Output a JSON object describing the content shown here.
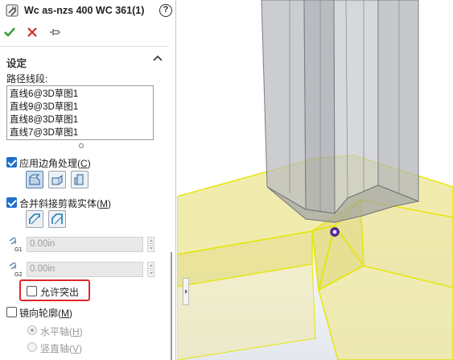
{
  "header": {
    "title": "Wc as-nzs 400 WC 361(1)",
    "help_glyph": "?"
  },
  "actions": {
    "ok_icon": "checkmark-icon",
    "cancel_icon": "close-icon",
    "pin_icon": "pushpin-icon",
    "ok_color": "#2a9a2a",
    "cancel_color": "#d22b2b"
  },
  "settings": {
    "title": "设定",
    "path_label": "路径线段:",
    "path_segments": [
      "直线6@3D草图1",
      "直线9@3D草图1",
      "直线8@3D草图1",
      "直线7@3D草图1"
    ],
    "corner_treatment": {
      "label": "应用边角处理",
      "hotkey": "C",
      "checked": true
    },
    "merge_miter": {
      "label": "合并斜接剪裁实体",
      "hotkey": "M",
      "checked": true
    },
    "gap1": {
      "value": "0.00in",
      "icon": "gap-g1-icon"
    },
    "gap2": {
      "value": "0.00in",
      "icon": "gap-g2-icon"
    },
    "allow_protrusion": {
      "label": "允许突出",
      "checked": false
    },
    "mirror_profile": {
      "label": "镜向轮廓",
      "hotkey": "M",
      "checked": false
    },
    "horizontal_axis": {
      "label": "水平轴",
      "hotkey": "H",
      "selected": true
    },
    "vertical_axis": {
      "label": "竖直轴",
      "hotkey": "V",
      "selected": false
    }
  },
  "colors": {
    "accent": "#1f6fd0",
    "highlight": "#e0262b",
    "member_fill": "#efe9a0",
    "member_edge": "#e6e600",
    "column_fill": "#b9bcc2"
  }
}
